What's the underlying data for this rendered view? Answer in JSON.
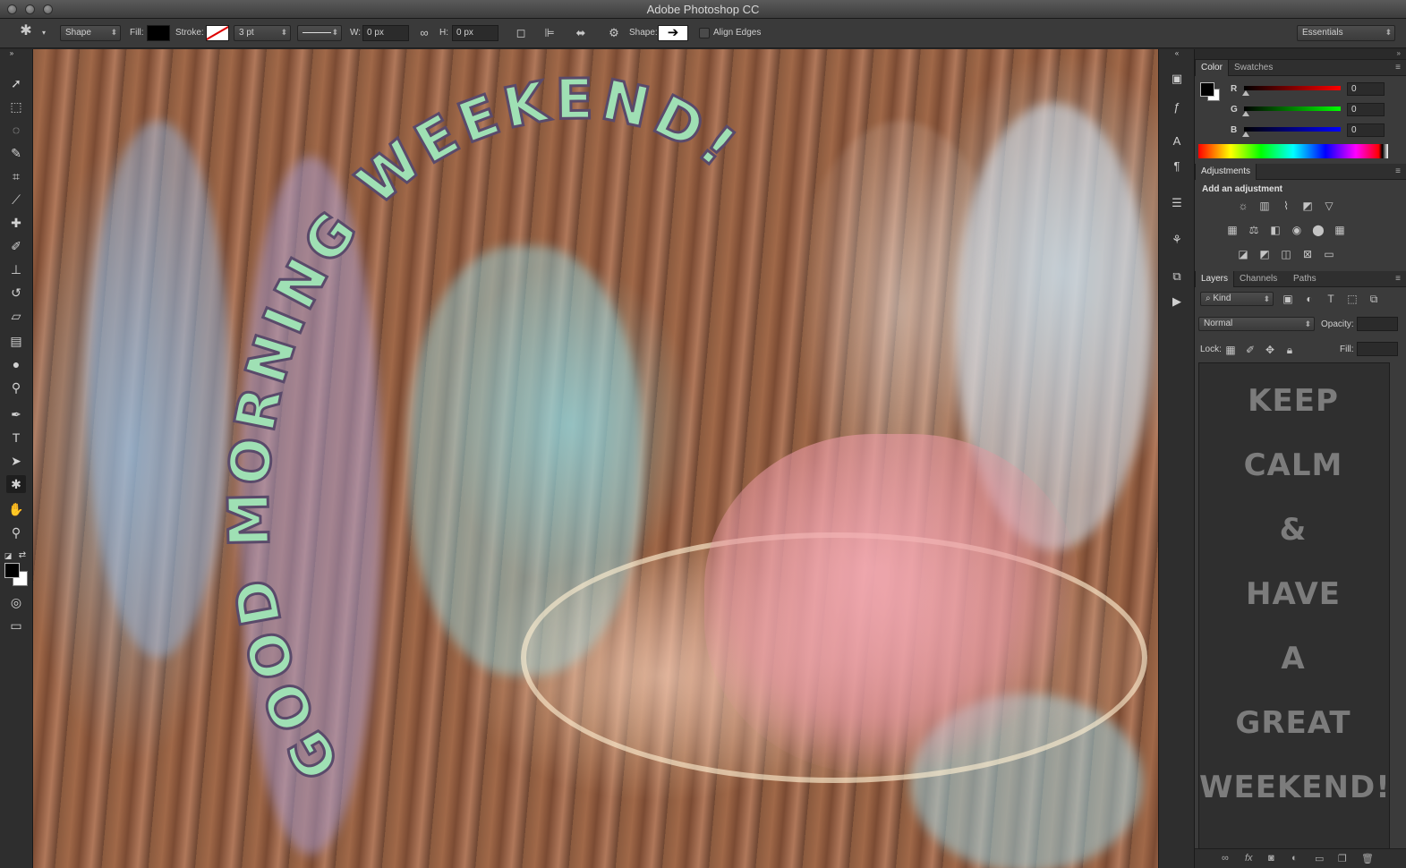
{
  "window": {
    "title": "Adobe Photoshop CC"
  },
  "options_bar": {
    "tool_mode": "Shape",
    "fill_label": "Fill:",
    "stroke_label": "Stroke:",
    "stroke_width": "3 pt",
    "w_label": "W:",
    "w_value": "0 px",
    "h_label": "H:",
    "h_value": "0 px",
    "shape_label": "Shape:",
    "align_edges_label": "Align Edges",
    "workspace": "Essentials",
    "colors": {
      "fill": "#000000",
      "stroke_bg": "#ffffff"
    }
  },
  "toolbar": {
    "tools": [
      "move-icon",
      "marquee-icon",
      "lasso-icon",
      "quick-selection-icon",
      "crop-icon",
      "eyedropper-icon",
      "healing-brush-icon",
      "brush-icon",
      "clone-stamp-icon",
      "history-brush-icon",
      "eraser-icon",
      "gradient-icon",
      "blur-icon",
      "dodge-icon",
      "pen-icon",
      "type-icon",
      "path-selection-icon",
      "custom-shape-icon",
      "hand-icon",
      "zoom-icon"
    ],
    "active_tool": "custom-shape-icon",
    "foreground": "#000000",
    "background": "#ffffff"
  },
  "canvas": {
    "arc_text": "GOOD MORNING WEEKEND!"
  },
  "color_panel": {
    "tabs": [
      "Color",
      "Swatches"
    ],
    "r_label": "R",
    "r_value": "0",
    "g_label": "G",
    "g_value": "0",
    "b_label": "B",
    "b_value": "0"
  },
  "adjustments_panel": {
    "tab": "Adjustments",
    "heading": "Add an adjustment"
  },
  "layers_panel": {
    "tabs": [
      "Layers",
      "Channels",
      "Paths"
    ],
    "filter_kind": "Kind",
    "blend_mode": "Normal",
    "opacity_label": "Opacity:",
    "lock_label": "Lock:",
    "fill_label": "Fill:",
    "preview_lines": [
      "KEEP",
      "CALM",
      "&",
      "HAVE",
      "A",
      "GREAT",
      "WEEKEND!"
    ]
  }
}
